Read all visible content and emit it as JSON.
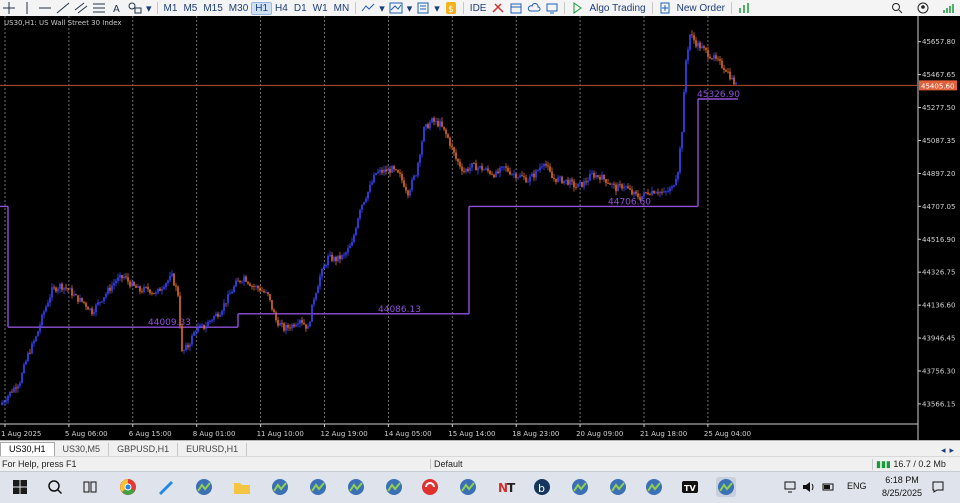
{
  "toolbar": {
    "timeframes": [
      "M1",
      "M5",
      "M15",
      "M30",
      "H1",
      "H4",
      "D1",
      "W1",
      "MN"
    ],
    "active_timeframe": "H1",
    "ide_label": "IDE",
    "algo_label": "Algo Trading",
    "new_order_label": "New Order"
  },
  "chart": {
    "title": "US30,H1:  US Wall Street 30 Index",
    "current_price": "45405.60",
    "level_labels": [
      "44009.33",
      "44086.13",
      "44706.60",
      "45326.90"
    ]
  },
  "chart_data": {
    "type": "candlestick",
    "symbol": "US30",
    "timeframe": "H1",
    "ylim": [
      43450,
      45760
    ],
    "y_ticks": [
      "45657.80",
      "45467.65",
      "45277.50",
      "45087.35",
      "44897.20",
      "44707.05",
      "44516.90",
      "44326.75",
      "44136.60",
      "43946.45",
      "43756.30",
      "43566.15"
    ],
    "x_ticks": [
      "1 Aug 2025",
      "5 Aug 06:00",
      "6 Aug 15:00",
      "8 Aug 01:00",
      "11 Aug 10:00",
      "12 Aug 19:00",
      "14 Aug 05:00",
      "15 Aug 14:00",
      "18 Aug 23:00",
      "20 Aug 09:00",
      "21 Aug 18:00",
      "25 Aug 04:00"
    ],
    "weekly_levels": [
      {
        "label": "44009.33",
        "value": 44009.33
      },
      {
        "label": "44086.13",
        "value": 44086.13
      },
      {
        "label": "44706.60",
        "value": 44706.6
      },
      {
        "label": "45326.90",
        "value": 45326.9
      }
    ],
    "current_price": 45405.6,
    "path": [
      [
        0,
        43560
      ],
      [
        10,
        43630
      ],
      [
        20,
        43700
      ],
      [
        28,
        43850
      ],
      [
        36,
        43950
      ],
      [
        44,
        44100
      ],
      [
        52,
        44220
      ],
      [
        60,
        44250
      ],
      [
        68,
        44230
      ],
      [
        76,
        44180
      ],
      [
        84,
        44150
      ],
      [
        92,
        44100
      ],
      [
        100,
        44160
      ],
      [
        108,
        44220
      ],
      [
        116,
        44280
      ],
      [
        124,
        44300
      ],
      [
        132,
        44250
      ],
      [
        140,
        44220
      ],
      [
        148,
        44230
      ],
      [
        156,
        44200
      ],
      [
        164,
        44260
      ],
      [
        172,
        44300
      ],
      [
        178,
        44200
      ],
      [
        182,
        43860
      ],
      [
        188,
        43900
      ],
      [
        196,
        44000
      ],
      [
        204,
        44010
      ],
      [
        212,
        44060
      ],
      [
        220,
        44100
      ],
      [
        228,
        44180
      ],
      [
        236,
        44260
      ],
      [
        244,
        44300
      ],
      [
        252,
        44250
      ],
      [
        260,
        44230
      ],
      [
        268,
        44190
      ],
      [
        276,
        44050
      ],
      [
        284,
        44000
      ],
      [
        292,
        44020
      ],
      [
        300,
        44060
      ],
      [
        308,
        44000
      ],
      [
        314,
        44180
      ],
      [
        320,
        44300
      ],
      [
        328,
        44410
      ],
      [
        336,
        44400
      ],
      [
        344,
        44420
      ],
      [
        352,
        44490
      ],
      [
        360,
        44700
      ],
      [
        368,
        44790
      ],
      [
        376,
        44900
      ],
      [
        384,
        44910
      ],
      [
        392,
        44920
      ],
      [
        400,
        44880
      ],
      [
        408,
        44790
      ],
      [
        416,
        44900
      ],
      [
        424,
        45150
      ],
      [
        432,
        45200
      ],
      [
        440,
        45180
      ],
      [
        448,
        45100
      ],
      [
        456,
        44980
      ],
      [
        464,
        44910
      ],
      [
        472,
        44940
      ],
      [
        480,
        44930
      ],
      [
        488,
        44910
      ],
      [
        496,
        44890
      ],
      [
        504,
        44930
      ],
      [
        512,
        44900
      ],
      [
        520,
        44880
      ],
      [
        528,
        44860
      ],
      [
        536,
        44900
      ],
      [
        544,
        44970
      ],
      [
        552,
        44870
      ],
      [
        560,
        44860
      ],
      [
        568,
        44850
      ],
      [
        576,
        44820
      ],
      [
        584,
        44840
      ],
      [
        592,
        44890
      ],
      [
        600,
        44880
      ],
      [
        608,
        44850
      ],
      [
        616,
        44810
      ],
      [
        624,
        44830
      ],
      [
        632,
        44780
      ],
      [
        640,
        44760
      ],
      [
        648,
        44790
      ],
      [
        656,
        44800
      ],
      [
        664,
        44780
      ],
      [
        672,
        44810
      ],
      [
        678,
        44920
      ],
      [
        682,
        45150
      ],
      [
        686,
        45550
      ],
      [
        690,
        45700
      ],
      [
        696,
        45650
      ],
      [
        702,
        45620
      ],
      [
        710,
        45580
      ],
      [
        718,
        45540
      ],
      [
        726,
        45500
      ],
      [
        732,
        45440
      ],
      [
        736,
        45405
      ]
    ]
  },
  "tabs": [
    "US30,H1",
    "US30,M5",
    "GBPUSD,H1",
    "EURUSD,H1"
  ],
  "active_tab": "US30,H1",
  "status": {
    "help": "For Help, press F1",
    "profile": "Default",
    "net": "16.7 / 0.2 Mb"
  },
  "taskbar": {
    "lang": "ENG",
    "time": "6:18 PM",
    "date": "8/25/2025"
  }
}
